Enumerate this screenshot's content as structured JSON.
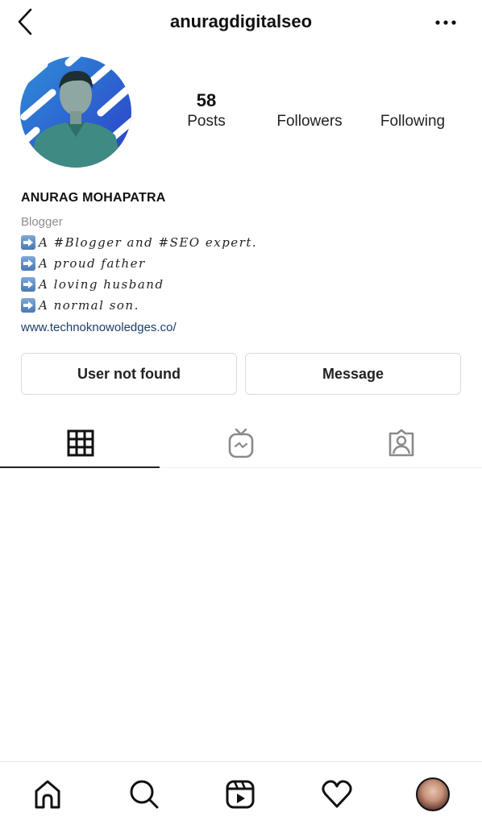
{
  "header": {
    "username": "anuragdigitalseo",
    "back_icon": "chevron-left-icon",
    "more_icon": "more-horizontal-icon"
  },
  "profile": {
    "stats": {
      "posts": {
        "value": "58",
        "label": "Posts"
      },
      "followers": {
        "value": "",
        "label": "Followers"
      },
      "following": {
        "value": "",
        "label": "Following"
      }
    },
    "full_name": "ANURAG MOHAPATRA",
    "category": "Blogger",
    "bio_lines": [
      "A #Blogger and #SEO expert.",
      "A proud father",
      "A loving husband",
      "A normal son."
    ],
    "bio_line_icon": "right-arrow-emoji",
    "website": "www.technoknowoledges.co/"
  },
  "actions": {
    "primary_label": "User not found",
    "message_label": "Message"
  },
  "tabs": [
    {
      "name": "posts-grid",
      "icon": "grid-icon",
      "active": true
    },
    {
      "name": "igtv",
      "icon": "igtv-icon",
      "active": false
    },
    {
      "name": "tagged",
      "icon": "tagged-person-icon",
      "active": false
    }
  ],
  "bottom_nav": [
    {
      "name": "home",
      "icon": "home-icon"
    },
    {
      "name": "search",
      "icon": "search-icon"
    },
    {
      "name": "reels",
      "icon": "reels-icon"
    },
    {
      "name": "activity",
      "icon": "heart-icon"
    },
    {
      "name": "profile",
      "icon": "avatar"
    }
  ],
  "colors": {
    "link": "#1a3d6e",
    "muted": "#8e8e8e",
    "border": "#dbdbdb",
    "text": "#111111"
  }
}
